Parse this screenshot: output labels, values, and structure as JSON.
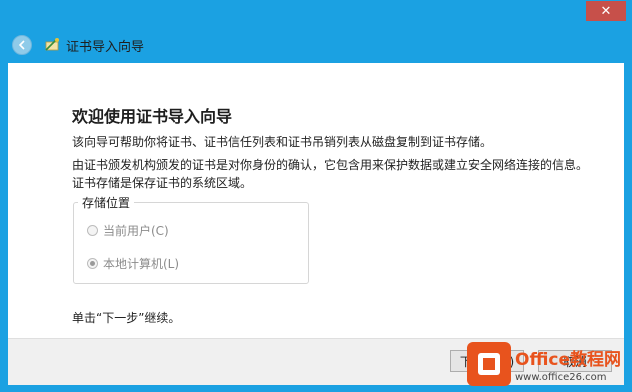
{
  "window": {
    "close_glyph": "✕",
    "accent": "#1ba1e2"
  },
  "nav": {
    "title": "证书导入向导",
    "back_icon": "back-arrow-icon",
    "wizard_icon": "certificate-wizard-icon"
  },
  "content": {
    "heading": "欢迎使用证书导入向导",
    "para1": "该向导可帮助你将证书、证书信任列表和证书吊销列表从磁盘复制到证书存储。",
    "para2": "由证书颁发机构颁发的证书是对你身份的确认，它包含用来保护数据或建立安全网络连接的信息。证书存储是保存证书的系统区域。",
    "store_location": {
      "label": "存储位置",
      "options": [
        {
          "label": "当前用户(C)",
          "checked": false
        },
        {
          "label": "本地计算机(L)",
          "checked": true
        }
      ]
    },
    "hint": "单击“下一步”继续。"
  },
  "footer": {
    "next_label": "下一步(N)",
    "cancel_label": "取消"
  },
  "watermark": {
    "line1": "Office教程网",
    "line2": "www.office26.com",
    "brand_color": "#e8531d"
  }
}
